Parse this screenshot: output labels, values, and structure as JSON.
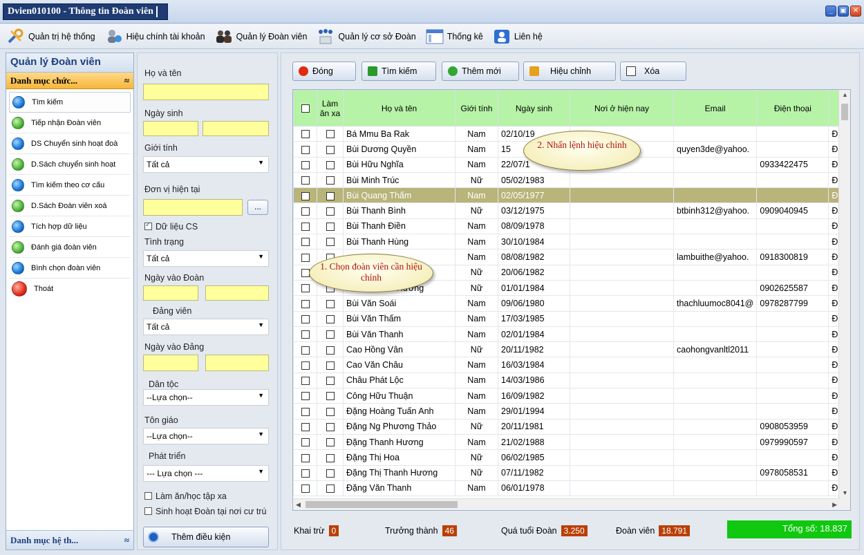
{
  "window": {
    "title": "Dvien010100 - Thông tin Đoàn viên"
  },
  "menu": [
    {
      "label": "Quản trị hệ thống",
      "icon": "tools-icon"
    },
    {
      "label": "Hiệu chính tài khoản",
      "icon": "user-edit-icon"
    },
    {
      "label": "Quản lý Đoàn viên",
      "icon": "users-icon"
    },
    {
      "label": "Quản lý cơ sở Đoàn",
      "icon": "org-icon"
    },
    {
      "label": "Thống kê",
      "icon": "chart-icon"
    },
    {
      "label": "Liên hệ",
      "icon": "contact-icon"
    }
  ],
  "sidebar": {
    "title": "Quản lý Đoàn viên",
    "group": "Danh mục chức...",
    "items": [
      {
        "label": "Tìm kiếm",
        "color": "blue"
      },
      {
        "label": "Tiếp nhận Đoàn viên",
        "color": "green"
      },
      {
        "label": "DS Chuyển sinh hoạt đoà",
        "color": "blue"
      },
      {
        "label": "D.Sách chuyển sinh hoạt",
        "color": "green"
      },
      {
        "label": "Tìm kiếm theo cơ cấu",
        "color": "blue"
      },
      {
        "label": "D.Sách Đoàn viên xoá",
        "color": "green"
      },
      {
        "label": "Tích hợp dữ liệu",
        "color": "blue"
      },
      {
        "label": "Đánh giá đoàn viên",
        "color": "green"
      },
      {
        "label": "Bình chọn đoàn viên",
        "color": "blue"
      },
      {
        "label": "Thoát",
        "color": "red"
      }
    ],
    "footer": "Danh mục hệ th..."
  },
  "filter": {
    "ho_ten": "Họ và tên",
    "ngay_sinh": "Ngày sinh",
    "gioi_tinh": "Giới tính",
    "gioi_tinh_value": "Tất cả",
    "don_vi": "Đơn vị hiện tại",
    "don_vi_btn": "...",
    "du_lieu_cs": "Dữ liệu CS",
    "tinh_trang": "Tình trạng",
    "tinh_trang_value": "Tất cả",
    "ngay_vao_doan": "Ngày vào Đoàn",
    "dang_vien": "Đảng viên",
    "dang_vien_value": "Tất cả",
    "ngay_vao_dang": "Ngày vào Đảng",
    "dan_toc": "Dân tộc",
    "dan_toc_value": "--Lựa chọn--",
    "ton_giao": "Tôn giáo",
    "ton_giao_value": "--Lựa chọn--",
    "phat_trien": "Phát triển",
    "phat_trien_value": "--- Lựa chọn ---",
    "lam_an_xa": "Làm ăn/học tập xa",
    "sinh_hoat": "Sinh hoạt Đoàn tại nơi cư trú",
    "add_condition": "Thêm điều kiện"
  },
  "toolbar": {
    "close": "Đóng",
    "search": "Tìm kiếm",
    "add": "Thêm mới",
    "edit": "Hiệu chỉnh",
    "delete": "Xóa"
  },
  "grid": {
    "headers": [
      "",
      "Làm ăn xa",
      "Họ và tên",
      "Giới tính",
      "Ngày sinh",
      "Nơi ở hiện nay",
      "Email",
      "Điện thoại",
      ""
    ],
    "rows": [
      {
        "name": "Bá Mmu Ba Rak",
        "sex": "Nam",
        "dob": "02/10/19",
        "email": "",
        "phone": "",
        "extra": "Đ"
      },
      {
        "name": "Bùi Dương Quyền",
        "sex": "Nam",
        "dob": "15",
        "email": "quyen3de@yahoo.",
        "phone": "",
        "extra": "Đ"
      },
      {
        "name": "Bùi Hữu Nghĩa",
        "sex": "Nam",
        "dob": "22/07/1",
        "email": "",
        "phone": "0933422475",
        "extra": "Đ"
      },
      {
        "name": "Bùi Minh Trúc",
        "sex": "Nữ",
        "dob": "05/02/1983",
        "email": "",
        "phone": "",
        "extra": "Đ"
      },
      {
        "name": "Bùi Quang Thấm",
        "sex": "Nam",
        "dob": "02/05/1977",
        "email": "",
        "phone": "",
        "extra": "Đ",
        "selected": true
      },
      {
        "name": "Bùi Thanh Bình",
        "sex": "Nữ",
        "dob": "03/12/1975",
        "email": "btbinh312@yahoo.",
        "phone": "0909040945",
        "extra": "Đ"
      },
      {
        "name": "Bùi Thanh Điền",
        "sex": "Nam",
        "dob": "08/09/1978",
        "email": "",
        "phone": "",
        "extra": "Đ"
      },
      {
        "name": "Bùi Thanh Hùng",
        "sex": "Nam",
        "dob": "30/10/1984",
        "email": "",
        "phone": "",
        "extra": "Đ"
      },
      {
        "name": "",
        "sex": "Nam",
        "dob": "08/08/1982",
        "email": "lambuithe@yahoo.",
        "phone": "0918300819",
        "extra": "Đ"
      },
      {
        "name": "",
        "sex": "Nữ",
        "dob": "20/06/1982",
        "email": "",
        "phone": "",
        "extra": "Đ"
      },
      {
        "name": "Bùi Thị Minh Hương",
        "sex": "Nữ",
        "dob": "01/01/1984",
        "email": "",
        "phone": "0902625587",
        "extra": "Đ"
      },
      {
        "name": "Bùi Văn Soái",
        "sex": "Nam",
        "dob": "09/06/1980",
        "email": "thachluumoc8041@",
        "phone": "0978287799",
        "extra": "Đ"
      },
      {
        "name": "Bùi Văn Thấm",
        "sex": "Nam",
        "dob": "17/03/1985",
        "email": "",
        "phone": "",
        "extra": "Đ"
      },
      {
        "name": "Bùi Văn Thanh",
        "sex": "Nam",
        "dob": "02/01/1984",
        "email": "",
        "phone": "",
        "extra": "Đ"
      },
      {
        "name": "Cao Hồng Vân",
        "sex": "Nữ",
        "dob": "20/11/1982",
        "email": "caohongvanltl2011",
        "phone": "",
        "extra": "Đ"
      },
      {
        "name": "Cao Văn Châu",
        "sex": "Nam",
        "dob": "16/03/1984",
        "email": "",
        "phone": "",
        "extra": "Đ"
      },
      {
        "name": "Châu Phát Lộc",
        "sex": "Nam",
        "dob": "14/03/1986",
        "email": "",
        "phone": "",
        "extra": "Đ"
      },
      {
        "name": "Công Hữu Thuận",
        "sex": "Nam",
        "dob": "16/09/1982",
        "email": "",
        "phone": "",
        "extra": "Đ"
      },
      {
        "name": "Đặng Hoàng Tuấn Anh",
        "sex": "Nam",
        "dob": "29/01/1994",
        "email": "",
        "phone": "",
        "extra": "Đ"
      },
      {
        "name": "Đặng Ng Phương Thảo",
        "sex": "Nữ",
        "dob": "20/11/1981",
        "email": "",
        "phone": "0908053959",
        "extra": "Đ"
      },
      {
        "name": "Đặng Thanh Hương",
        "sex": "Nam",
        "dob": "21/02/1988",
        "email": "",
        "phone": "0979990597",
        "extra": "Đ"
      },
      {
        "name": "Đặng Thị Hoa",
        "sex": "Nữ",
        "dob": "06/02/1985",
        "email": "",
        "phone": "",
        "extra": "Đ"
      },
      {
        "name": "Đặng Thị Thanh Hương",
        "sex": "Nữ",
        "dob": "07/11/1982",
        "email": "",
        "phone": "0978058531",
        "extra": "Đ"
      },
      {
        "name": "Đặng Văn Thanh",
        "sex": "Nam",
        "dob": "06/01/1978",
        "email": "",
        "phone": "",
        "extra": "Đ"
      }
    ]
  },
  "callouts": {
    "step1": "1. Chọn đoàn viên cần hiệu chỉnh",
    "step2": "2. Nhấn lệnh hiệu chỉnh"
  },
  "status": {
    "khai_tru_label": "Khai trừ",
    "khai_tru": "0",
    "truong_thanh_label": "Trưởng thành",
    "truong_thanh": "46",
    "qua_tuoi_label": "Quá tuổi Đoàn",
    "qua_tuoi": "3.250",
    "doan_vien_label": "Đoàn viên",
    "doan_vien": "18.791",
    "total": "Tổng số: 18.837"
  }
}
